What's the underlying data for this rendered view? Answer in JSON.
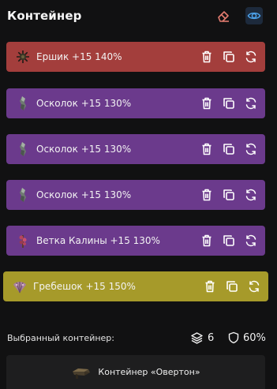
{
  "header": {
    "title": "Контейнер",
    "eraser_icon": "eraser-icon",
    "eye_icon": "eye-icon",
    "eraser_color": "#e07a6e",
    "eye_color": "#4b9fe6"
  },
  "items": [
    {
      "label": "Ершик +15 140%",
      "color": "#a33e3c",
      "icon": "urchin-icon"
    },
    {
      "label": "Осколок +15 130%",
      "color": "#6b3a8c",
      "icon": "shard-icon"
    },
    {
      "label": "Осколок +15 130%",
      "color": "#6b3a8c",
      "icon": "shard-icon"
    },
    {
      "label": "Осколок +15 130%",
      "color": "#6b3a8c",
      "icon": "shard-icon"
    },
    {
      "label": "Ветка Калины +15 130%",
      "color": "#6b3a8c",
      "icon": "branch-icon"
    },
    {
      "label": "Гребешок +15 150%",
      "color": "#a69a2a",
      "icon": "scallop-icon"
    }
  ],
  "row_actions": [
    "trash-icon",
    "copy-icon",
    "refresh-icon"
  ],
  "footer": {
    "label": "Выбранный контейнер:",
    "count": "6",
    "percent": "60%",
    "container_name": "Контейнер «Овертон»"
  }
}
